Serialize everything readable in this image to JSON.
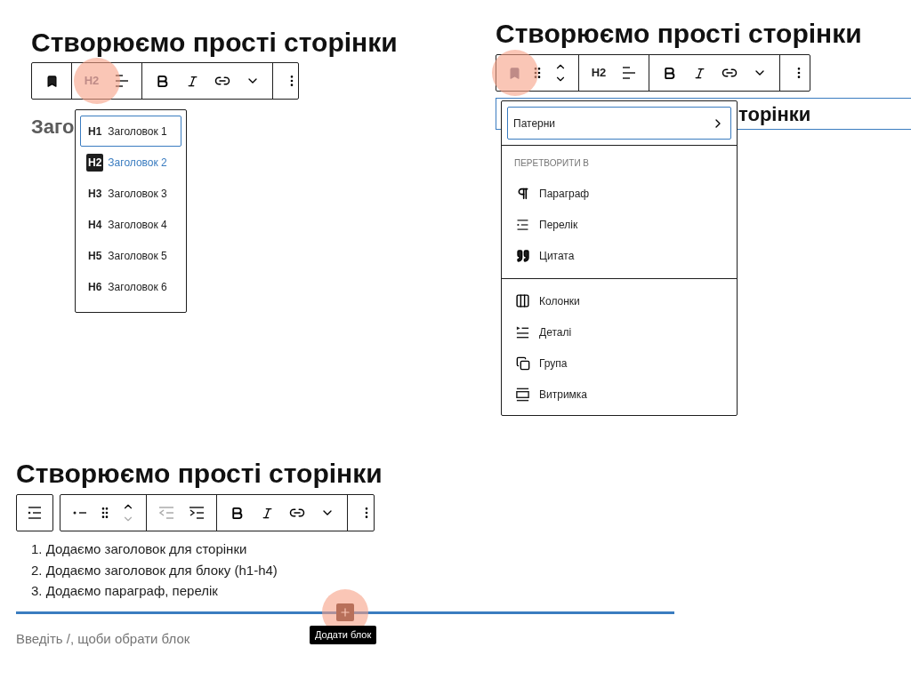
{
  "heading_menu_example": {
    "heading": "Створюємо прості сторінки",
    "level_button": "H2",
    "partial_text": "Заго",
    "levels": [
      {
        "tag": "H1",
        "label": "Заголовок 1",
        "selected": false,
        "focused": true
      },
      {
        "tag": "H2",
        "label": "Заголовок 2",
        "selected": true,
        "focused": false
      },
      {
        "tag": "H3",
        "label": "Заголовок 3",
        "selected": false,
        "focused": false
      },
      {
        "tag": "H4",
        "label": "Заголовок 4",
        "selected": false,
        "focused": false
      },
      {
        "tag": "H5",
        "label": "Заголовок 5",
        "selected": false,
        "focused": false
      },
      {
        "tag": "H6",
        "label": "Заголовок 6",
        "selected": false,
        "focused": false
      }
    ]
  },
  "transform_example": {
    "heading": "Створюємо прості сторінки",
    "level_button": "H2",
    "selected_block_text": "торінки",
    "patterns_item": "Патерни",
    "section_title": "ПЕРЕТВОРИТИ В",
    "groups": [
      [
        "Параграф",
        "Перелік",
        "Цитата"
      ],
      [
        "Колонки",
        "Деталі",
        "Група",
        "Витримка"
      ]
    ]
  },
  "list_example": {
    "heading": "Створюємо прості сторінки",
    "items": [
      {
        "number": "1.",
        "text": "Додаємо заголовок для сторінки"
      },
      {
        "number": "2.",
        "text": "Додаємо заголовок для блоку (h1-h4)"
      },
      {
        "number": "3.",
        "text": "Додаємо параграф, перелік"
      }
    ],
    "placeholder": "Введіть /, щоби обрати блок",
    "tooltip": "Додати блок"
  }
}
